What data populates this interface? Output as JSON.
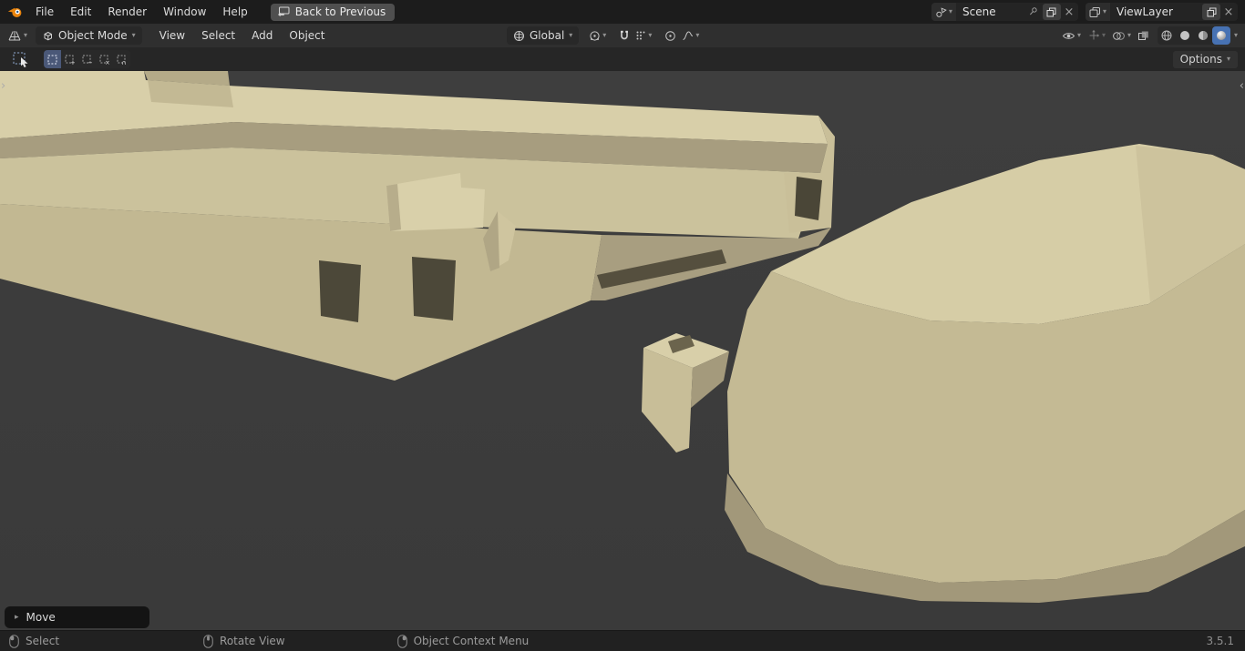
{
  "topbar": {
    "menus": [
      "File",
      "Edit",
      "Render",
      "Window",
      "Help"
    ],
    "back_button": "Back to Previous",
    "scene": {
      "value": "Scene"
    },
    "view_layer": {
      "value": "ViewLayer"
    }
  },
  "viewport_header": {
    "mode": "Object Mode",
    "menus": [
      "View",
      "Select",
      "Add",
      "Object"
    ],
    "orientation": "Global"
  },
  "tool_settings": {
    "options_label": "Options"
  },
  "viewport": {
    "operator_panel_label": "Move"
  },
  "statusbar": {
    "keymap": [
      {
        "button": "left-mouse",
        "label": "Select"
      },
      {
        "button": "middle-mouse",
        "label": "Rotate View"
      },
      {
        "button": "right-mouse",
        "label": "Object Context Menu"
      }
    ],
    "version": "3.5.1"
  },
  "icons": {
    "dropdown": "▾",
    "close": "×",
    "collapsed": "▸",
    "chevron_left": "‹",
    "chevron_right": "›",
    "mode_add": "+",
    "mode_sub": "−",
    "mode_invert": "×",
    "mode_intersect": "∩"
  },
  "colors": {
    "accent": "#4772b3",
    "viewport_background": "#3d3d3d",
    "model_top": "#d7cea7",
    "model_side": "#c4ba94",
    "model_shadow": "#a2987a"
  }
}
